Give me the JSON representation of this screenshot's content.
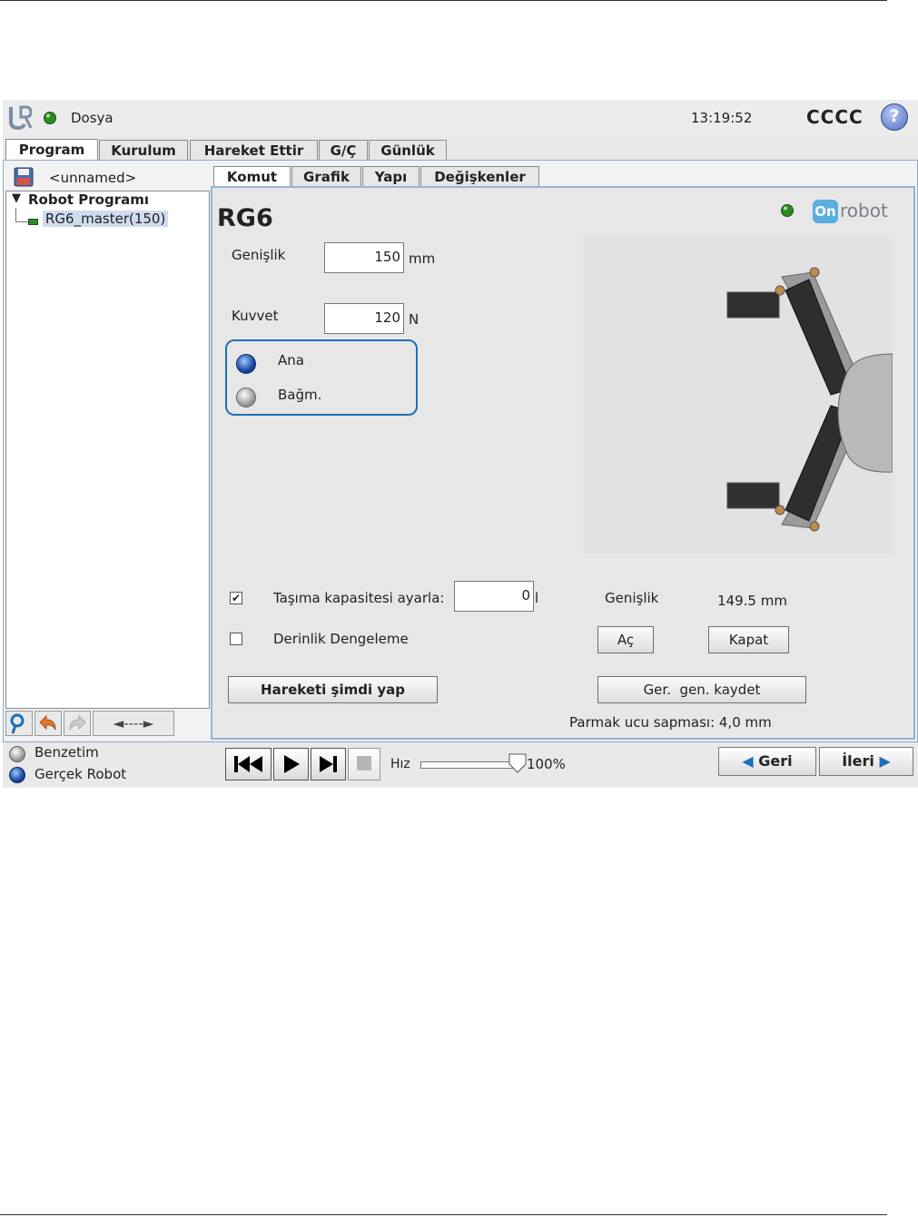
{
  "window": {
    "menu_label": "Dosya",
    "time": "13:19:52",
    "robot_name": "CCCC",
    "help_symbol": "?"
  },
  "main_tabs": [
    {
      "label": "Program",
      "active": true
    },
    {
      "label": "Kurulum"
    },
    {
      "label": "Hareket Ettir"
    },
    {
      "label": "G/Ç"
    },
    {
      "label": "Günlük"
    }
  ],
  "program_tree": {
    "file_name": "<unnamed>",
    "root": "Robot Programı",
    "node": "RG6_master(150)"
  },
  "sub_tabs": [
    {
      "label": "Komut",
      "active": true
    },
    {
      "label": "Grafik"
    },
    {
      "label": "Yapı"
    },
    {
      "label": "Değişkenler"
    }
  ],
  "command": {
    "title": "RG6",
    "brand_prefix": "On",
    "brand_text": "robot",
    "width_label": "Genişlik",
    "width_value": "150",
    "width_unit": "mm",
    "force_label": "Kuvvet",
    "force_value": "120",
    "force_unit": "N",
    "radio_master": "Ana",
    "radio_slave": "Bağm.",
    "payload_label": "Taşıma kapasitesi ayarla:",
    "payload_checked": true,
    "payload_value": "0",
    "payload_unit": "l",
    "depth_label": "Derinlik Dengeleme",
    "depth_checked": false,
    "current_width_label": "Genişlik",
    "current_width_value": "149.5 mm",
    "open_btn": "Aç",
    "close_btn": "Kapat",
    "move_now_btn": "Hareketi şimdi yap",
    "save_width_btn": "Ger.  gen. kaydet",
    "fingertip_offset": "Parmak ucu sapması: 4,0 mm"
  },
  "tree_toolbar": {
    "arrow_label": "◄----►"
  },
  "status": {
    "simulation": "Benzetim",
    "real_robot": "Gerçek Robot"
  },
  "playback": {
    "speed_label": "Hız",
    "speed_value": "100%",
    "speed_fraction": 1.0
  },
  "nav": {
    "back": "Geri",
    "next": "İleri"
  },
  "colors": {
    "accent_blue": "#1d70b8",
    "panel_border": "#98b3d4",
    "status_green": "#2a8a22"
  }
}
